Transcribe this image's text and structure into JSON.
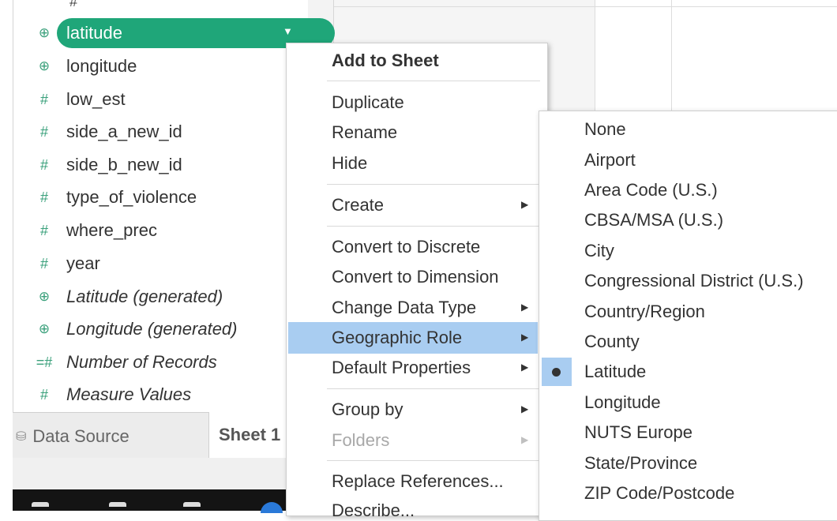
{
  "fields": {
    "top_fragment": "#",
    "items": [
      {
        "icon": "globe-icon",
        "name": "latitude",
        "selected": true
      },
      {
        "icon": "globe-icon",
        "name": "longitude"
      },
      {
        "icon": "hash-icon",
        "name": "low_est"
      },
      {
        "icon": "hash-icon",
        "name": "side_a_new_id"
      },
      {
        "icon": "hash-icon",
        "name": "side_b_new_id"
      },
      {
        "icon": "hash-icon",
        "name": "type_of_violence"
      },
      {
        "icon": "hash-icon",
        "name": "where_prec"
      },
      {
        "icon": "hash-icon",
        "name": "year"
      },
      {
        "icon": "globe-icon",
        "name": "Latitude (generated)",
        "italic": true
      },
      {
        "icon": "globe-icon",
        "name": "Longitude (generated)",
        "italic": true
      },
      {
        "icon": "calc-hash-icon",
        "name": "Number of Records",
        "italic": true
      },
      {
        "icon": "hash-icon",
        "name": "Measure Values",
        "italic": true
      }
    ],
    "pill_color": "#1fa679",
    "icon_color": "#3aa07b"
  },
  "tabs": {
    "data_source": "Data Source",
    "sheet": "Sheet 1"
  },
  "context_menu": {
    "items": [
      {
        "label": "Add to Sheet",
        "bold": true
      },
      {
        "label": "Duplicate"
      },
      {
        "label": "Rename"
      },
      {
        "label": "Hide"
      },
      {
        "label": "Create",
        "submenu": true
      },
      {
        "label": "Convert to Discrete"
      },
      {
        "label": "Convert to Dimension"
      },
      {
        "label": "Change Data Type",
        "submenu": true
      },
      {
        "label": "Geographic Role",
        "submenu": true,
        "highlighted": true
      },
      {
        "label": "Default Properties",
        "submenu": true
      },
      {
        "label": "Group by",
        "submenu": true
      },
      {
        "label": "Folders",
        "submenu": true,
        "disabled": true
      },
      {
        "label": "Replace References..."
      },
      {
        "label": "Describe..."
      }
    ],
    "highlight_color": "#a9cdf1"
  },
  "geographic_role_menu": {
    "items": [
      {
        "label": "None"
      },
      {
        "label": "Airport"
      },
      {
        "label": "Area Code (U.S.)"
      },
      {
        "label": "CBSA/MSA (U.S.)"
      },
      {
        "label": "City"
      },
      {
        "label": "Congressional District (U.S.)"
      },
      {
        "label": "Country/Region"
      },
      {
        "label": "County"
      },
      {
        "label": "Latitude",
        "checked": true
      },
      {
        "label": "Longitude"
      },
      {
        "label": "NUTS Europe"
      },
      {
        "label": "State/Province"
      },
      {
        "label": "ZIP Code/Postcode"
      }
    ]
  }
}
